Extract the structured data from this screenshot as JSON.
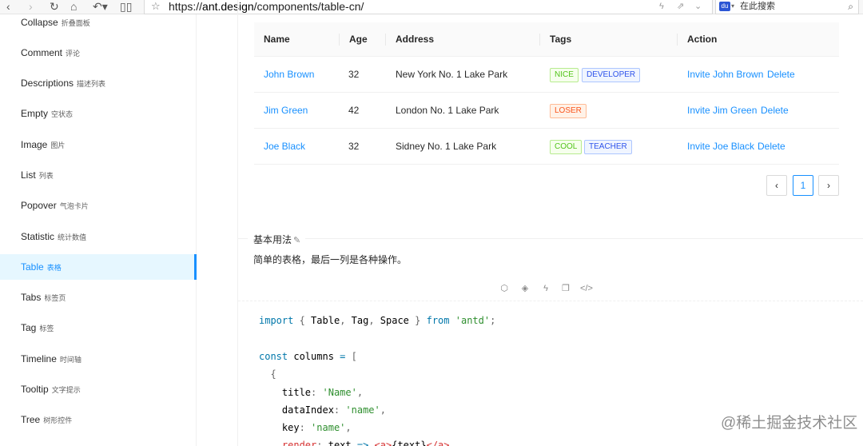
{
  "browser": {
    "url_scheme": "https://",
    "url_host": "ant.design",
    "url_path": "/components/table-cn/",
    "search_placeholder": "在此搜索",
    "icons": [
      "back-icon",
      "forward-icon",
      "reload-icon",
      "home-icon",
      "undo-icon",
      "reader-icon",
      "star-icon",
      "bolt-icon",
      "share-icon",
      "dropdown-icon",
      "search-icon"
    ]
  },
  "sidebar": {
    "items": [
      {
        "en": "Collapse",
        "cn": "折叠面板"
      },
      {
        "en": "Comment",
        "cn": "评论"
      },
      {
        "en": "Descriptions",
        "cn": "描述列表"
      },
      {
        "en": "Empty",
        "cn": "空状态"
      },
      {
        "en": "Image",
        "cn": "图片"
      },
      {
        "en": "List",
        "cn": "列表"
      },
      {
        "en": "Popover",
        "cn": "气泡卡片"
      },
      {
        "en": "Statistic",
        "cn": "统计数值"
      },
      {
        "en": "Table",
        "cn": "表格"
      },
      {
        "en": "Tabs",
        "cn": "标签页"
      },
      {
        "en": "Tag",
        "cn": "标签"
      },
      {
        "en": "Timeline",
        "cn": "时间轴"
      },
      {
        "en": "Tooltip",
        "cn": "文字提示"
      },
      {
        "en": "Tree",
        "cn": "树形控件"
      }
    ],
    "active_index": 8
  },
  "table": {
    "columns": [
      "Name",
      "Age",
      "Address",
      "Tags",
      "Action"
    ],
    "rows": [
      {
        "name": "John Brown",
        "age": "32",
        "address": "New York No. 1 Lake Park",
        "tags": [
          "NICE",
          "DEVELOPER"
        ],
        "invite": "Invite John Brown",
        "delete": "Delete"
      },
      {
        "name": "Jim Green",
        "age": "42",
        "address": "London No. 1 Lake Park",
        "tags": [
          "LOSER"
        ],
        "invite": "Invite Jim Green",
        "delete": "Delete"
      },
      {
        "name": "Joe Black",
        "age": "32",
        "address": "Sidney No. 1 Lake Park",
        "tags": [
          "COOL",
          "TEACHER"
        ],
        "invite": "Invite Joe Black",
        "delete": "Delete"
      }
    ],
    "tag_colors": {
      "NICE": "#52c41a",
      "DEVELOPER": "#2f54eb",
      "LOSER": "#fa541c",
      "COOL": "#52c41a",
      "TEACHER": "#2f54eb"
    }
  },
  "pagination": {
    "prev": "‹",
    "current": "1",
    "next": "›"
  },
  "demo": {
    "title": "基本用法",
    "description": "简单的表格，最后一列是各种操作。",
    "action_icons": [
      "codesandbox-icon",
      "codepen-icon",
      "riddle-icon",
      "copy-icon",
      "code-icon"
    ]
  },
  "code": {
    "lines": [
      "import { Table, Tag, Space } from 'antd';",
      "",
      "const columns = [",
      "  {",
      "    title: 'Name',",
      "    dataIndex: 'name',",
      "    key: 'name',",
      "    render: text => <a>{text}</a>,"
    ]
  },
  "watermark": "@稀土掘金技术社区",
  "accent_color": "#1890ff"
}
